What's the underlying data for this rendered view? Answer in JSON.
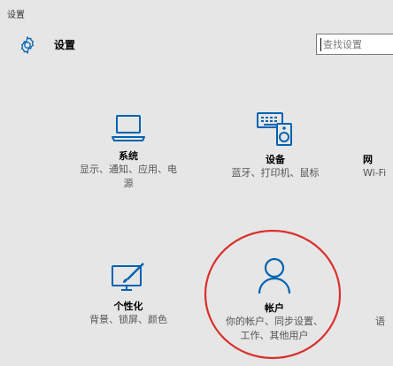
{
  "window": {
    "title": "设置"
  },
  "header": {
    "title": "设置",
    "icon": "gear-icon"
  },
  "search": {
    "placeholder": "查找设置",
    "value": ""
  },
  "tiles": [
    {
      "name": "系统",
      "desc": [
        "显示、通知、应用、电",
        "源"
      ],
      "icon": "laptop-icon"
    },
    {
      "name": "设备",
      "desc": [
        "蓝牙、打印机、鼠标"
      ],
      "icon": "keyboard-speaker-icon"
    },
    {
      "name": "网",
      "desc": [
        "Wi-Fi"
      ],
      "icon": "network-icon"
    },
    {
      "name": "个性化",
      "desc": [
        "背景、锁屏、颜色"
      ],
      "icon": "paint-monitor-icon"
    },
    {
      "name": "帐户",
      "desc": [
        "你的帐户、同步设置、",
        "工作、其他用户"
      ],
      "icon": "person-icon"
    },
    {
      "name": "",
      "desc": [
        "语"
      ],
      "icon": ""
    }
  ],
  "colors": {
    "accent": "#0063b1",
    "annotation": "#d9302c",
    "background": "#e6e6e6"
  }
}
